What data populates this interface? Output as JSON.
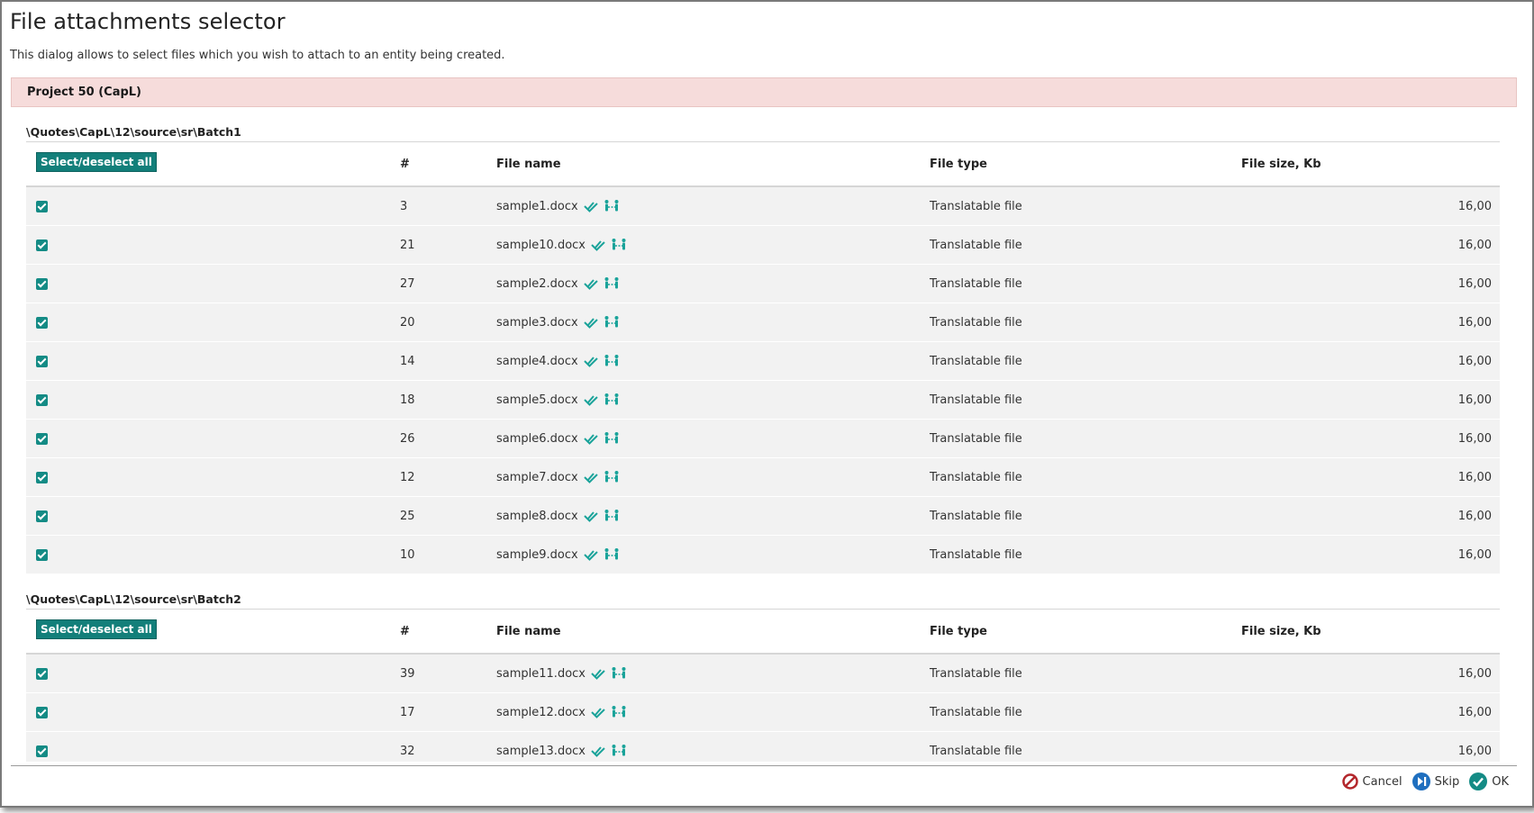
{
  "dialog": {
    "title": "File attachments selector",
    "description": "This dialog allows to select files which you wish to attach to an entity being created."
  },
  "project": {
    "name": "Project 50 (CapL)"
  },
  "columns": {
    "select_all": "Select/deselect all",
    "number": "#",
    "file_name": "File name",
    "file_type": "File type",
    "file_size": "File size, Kb"
  },
  "batches": [
    {
      "path": "\\Quotes\\CapL\\12\\source\\sr\\Batch1",
      "rows": [
        {
          "checked": true,
          "num": "3",
          "name": "sample1.docx",
          "type": "Translatable file",
          "size": "16,00"
        },
        {
          "checked": true,
          "num": "21",
          "name": "sample10.docx",
          "type": "Translatable file",
          "size": "16,00"
        },
        {
          "checked": true,
          "num": "27",
          "name": "sample2.docx",
          "type": "Translatable file",
          "size": "16,00"
        },
        {
          "checked": true,
          "num": "20",
          "name": "sample3.docx",
          "type": "Translatable file",
          "size": "16,00"
        },
        {
          "checked": true,
          "num": "14",
          "name": "sample4.docx",
          "type": "Translatable file",
          "size": "16,00"
        },
        {
          "checked": true,
          "num": "18",
          "name": "sample5.docx",
          "type": "Translatable file",
          "size": "16,00"
        },
        {
          "checked": true,
          "num": "26",
          "name": "sample6.docx",
          "type": "Translatable file",
          "size": "16,00"
        },
        {
          "checked": true,
          "num": "12",
          "name": "sample7.docx",
          "type": "Translatable file",
          "size": "16,00"
        },
        {
          "checked": true,
          "num": "25",
          "name": "sample8.docx",
          "type": "Translatable file",
          "size": "16,00"
        },
        {
          "checked": true,
          "num": "10",
          "name": "sample9.docx",
          "type": "Translatable file",
          "size": "16,00"
        }
      ]
    },
    {
      "path": "\\Quotes\\CapL\\12\\source\\sr\\Batch2",
      "rows": [
        {
          "checked": true,
          "num": "39",
          "name": "sample11.docx",
          "type": "Translatable file",
          "size": "16,00"
        },
        {
          "checked": true,
          "num": "17",
          "name": "sample12.docx",
          "type": "Translatable file",
          "size": "16,00"
        },
        {
          "checked": true,
          "num": "32",
          "name": "sample13.docx",
          "type": "Translatable file",
          "size": "16,00"
        }
      ]
    }
  ],
  "footer": {
    "cancel": "Cancel",
    "skip": "Skip",
    "ok": "OK"
  },
  "icons": {
    "row_status": "double-check-icon",
    "row_link": "link-people-icon",
    "cancel": "cancel-circle-icon",
    "skip": "skip-next-icon",
    "ok": "ok-check-icon"
  },
  "colors": {
    "accent": "#137f7a",
    "project_header_bg": "#f6dcdb",
    "cancel": "#b3262b",
    "skip": "#1f6fbf",
    "ok": "#148b85"
  }
}
